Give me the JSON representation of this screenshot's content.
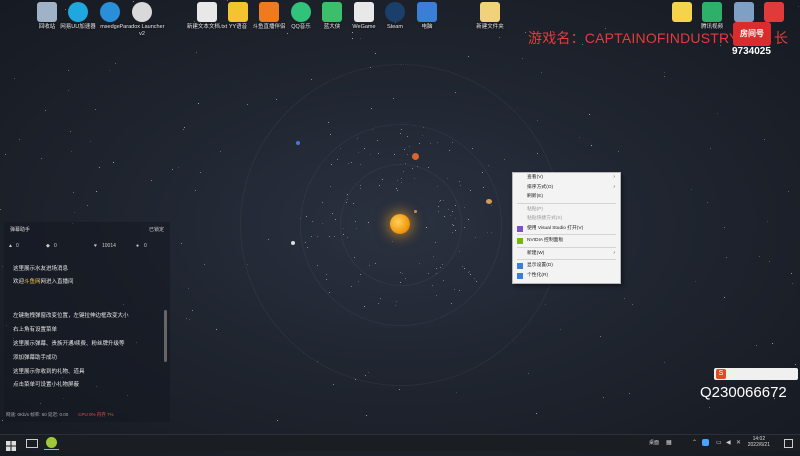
{
  "desktop_icons": [
    {
      "label": "回收站",
      "color": "#9fb3c8"
    },
    {
      "label": "网易UU加速器",
      "color": "#1fa8e0"
    },
    {
      "label": "msedge",
      "color": "#2a8fd8"
    },
    {
      "label": "Paradox Launcher v2",
      "color": "#d9d9d9"
    },
    {
      "label": "新建文本文档.txt",
      "color": "#e8e8e8"
    },
    {
      "label": "YY语音",
      "color": "#f4c430"
    },
    {
      "label": "斗鱼直播伴侣",
      "color": "#f07a1e"
    },
    {
      "label": "QQ音乐",
      "color": "#31c27c"
    },
    {
      "label": "蓝大侠",
      "color": "#3bbf6a"
    },
    {
      "label": "WeGame",
      "color": "#e8e8e8"
    },
    {
      "label": "Steam",
      "color": "#1b3f6b"
    },
    {
      "label": "电脑",
      "color": "#3a7fd5"
    },
    {
      "label": "新建文件夹",
      "color": "#f1d27a"
    },
    {
      "label": "",
      "color": "#f5d34a"
    },
    {
      "label": "腾讯视频",
      "color": "#2fb06a"
    },
    {
      "label": "",
      "color": "#7da0c4"
    },
    {
      "label": "",
      "color": "#e03a3a"
    }
  ],
  "overlay": {
    "game_name": "游戏名：CAPTAINOFINDUSTRY",
    "logo_text": "房间号",
    "logo_suffix": "长",
    "room_number": "9734025",
    "qq": "Q230066672"
  },
  "context_menu": {
    "items": [
      {
        "label": "查看(V)",
        "submenu": true,
        "disabled": false
      },
      {
        "label": "排序方式(O)",
        "submenu": true,
        "disabled": false
      },
      {
        "label": "刷新(E)",
        "submenu": false,
        "disabled": false
      },
      {
        "sep": true
      },
      {
        "label": "粘贴(P)",
        "submenu": false,
        "disabled": true
      },
      {
        "label": "粘贴快捷方式(S)",
        "submenu": false,
        "disabled": true
      },
      {
        "label": "使用 Visual Studio 打开(V)",
        "submenu": false,
        "disabled": false,
        "icon": "#7b4fd0"
      },
      {
        "sep": true
      },
      {
        "label": "NVIDIA 控制面板",
        "submenu": false,
        "disabled": false,
        "icon": "#76b900"
      },
      {
        "sep": true
      },
      {
        "label": "新建(W)",
        "submenu": true,
        "disabled": false
      },
      {
        "sep": true
      },
      {
        "label": "显示设置(D)",
        "submenu": false,
        "disabled": false,
        "icon": "#3a7fd5"
      },
      {
        "label": "个性化(R)",
        "submenu": false,
        "disabled": false,
        "icon": "#3a7fd5"
      }
    ]
  },
  "chat": {
    "title": "弹幕助手",
    "lock": "已锁定",
    "stats": [
      "0",
      "0",
      "10014",
      "0"
    ],
    "lines": [
      {
        "text": "这里展示水友进场消息"
      },
      {
        "prefix": "欢迎",
        "highlight": "斗鱼网",
        "suffix": "网进入直播间"
      },
      {
        "text": "左键拖拽弹窗改变位置，左键拉伸边框改变大小"
      },
      {
        "text": "右上角有设置菜单"
      },
      {
        "text": "这里展示弹幕、贵族开通/续费、粉丝牌升级等"
      },
      {
        "text": "添加弹幕助手成功"
      },
      {
        "text": "这里展示你收到的礼物、道具"
      },
      {
        "text": "点击菜单可设置小礼物屏蔽"
      }
    ],
    "footer": "网速: 0Kb/s  帧率: 60  延迟: 0.00",
    "footer_cpu": "CPU 0%  内存 7%"
  },
  "taskbar": {
    "tray_text": "桌面",
    "time": "14:02",
    "date": "2022/6/21"
  }
}
